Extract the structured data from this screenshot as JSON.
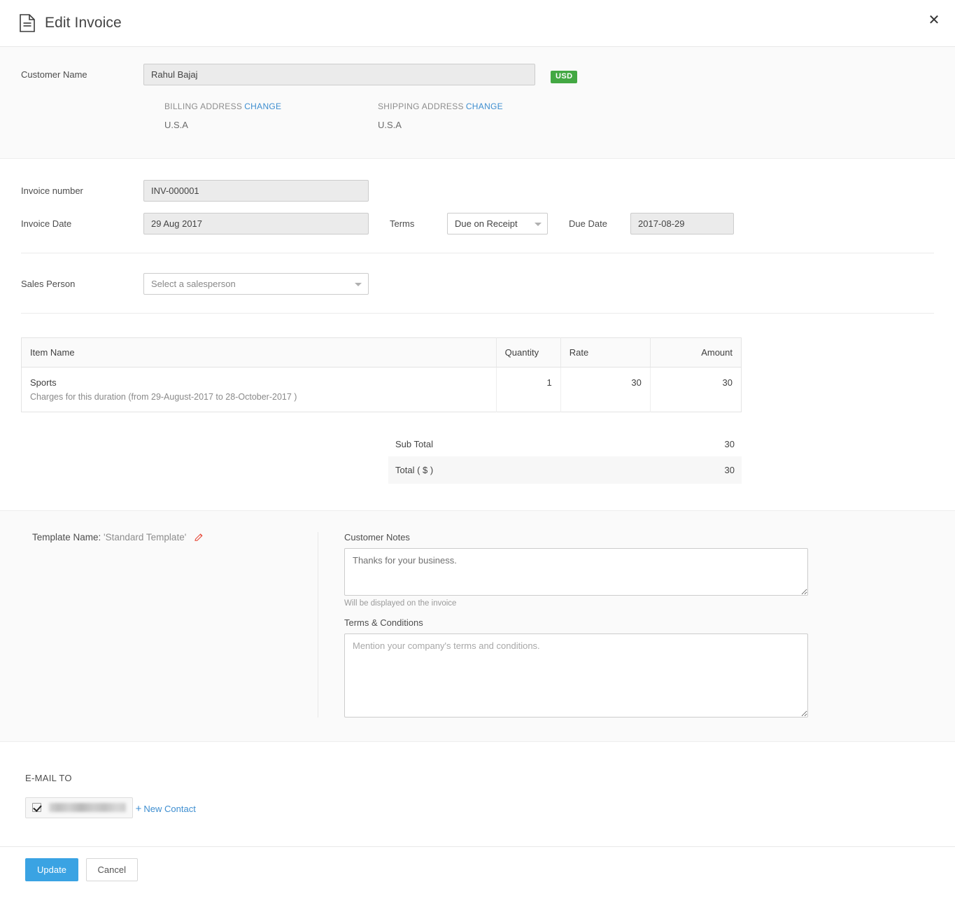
{
  "header": {
    "title": "Edit Invoice",
    "doc_icon": "document-icon",
    "close_icon": "✕"
  },
  "customer": {
    "label": "Customer Name",
    "value": "Rahul Bajaj",
    "currency_badge": "USD",
    "billing": {
      "heading": "BILLING ADDRESS",
      "change_label": "CHANGE",
      "address": "U.S.A"
    },
    "shipping": {
      "heading": "SHIPPING ADDRESS",
      "change_label": "CHANGE",
      "address": "U.S.A"
    }
  },
  "invoice": {
    "number_label": "Invoice number",
    "number_value": "INV-000001",
    "date_label": "Invoice Date",
    "date_value": "29 Aug 2017",
    "terms_label": "Terms",
    "terms_value": "Due on Receipt",
    "due_date_label": "Due Date",
    "due_date_value": "2017-08-29",
    "sales_person_label": "Sales Person",
    "sales_person_placeholder": "Select a salesperson"
  },
  "items_table": {
    "columns": [
      "Item Name",
      "Quantity",
      "Rate",
      "Amount"
    ],
    "rows": [
      {
        "name": "Sports",
        "description": "Charges for this duration (from 29-August-2017 to 28-October-2017 )",
        "quantity": "1",
        "rate": "30",
        "amount": "30"
      }
    ]
  },
  "totals": {
    "sub_total_label": "Sub Total",
    "sub_total_value": "30",
    "total_label": "Total ( $ )",
    "total_value": "30"
  },
  "template": {
    "prefix": "Template Name: ",
    "name": "'Standard Template'",
    "edit_icon": "pencil-icon"
  },
  "notes": {
    "customer_notes_label": "Customer Notes",
    "customer_notes_value": "Thanks for your business.",
    "customer_notes_help": "Will be displayed on the invoice",
    "terms_label": "Terms & Conditions",
    "terms_placeholder": "Mention your company's terms and conditions."
  },
  "email": {
    "label": "E-MAIL TO",
    "contact_checked": true,
    "contact_address": "",
    "new_contact_label": "New Contact",
    "new_contact_plus": "+"
  },
  "footer": {
    "update_label": "Update",
    "cancel_label": "Cancel"
  },
  "colors": {
    "accent_blue": "#3aa3e3",
    "link_blue": "#3e8ed0",
    "badge_green": "#43a843",
    "pencil_red": "#e74c3c"
  }
}
